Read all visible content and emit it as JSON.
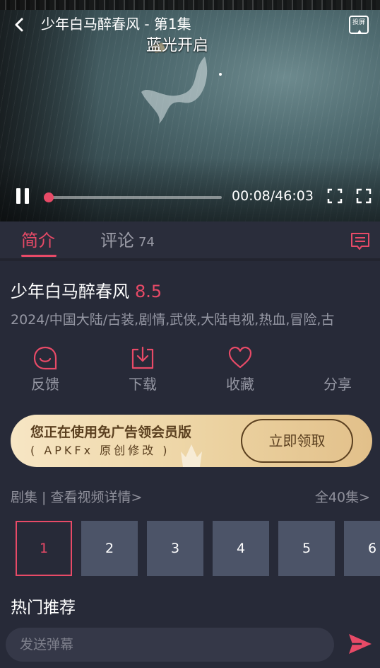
{
  "player": {
    "title": "少年白马醉春风 - 第1集",
    "overlay_text": "蓝光开启",
    "cast_label": "投屏",
    "time": "00:08/46:03",
    "progress": 0.003
  },
  "tabs": {
    "intro_label": "简介",
    "comments_label": "评论",
    "comments_count": "74"
  },
  "show": {
    "title": "少年白马醉春风",
    "rating": "8.5",
    "meta": "2024/中国大陆/古装,剧情,武侠,大陆电视,热血,冒险,古"
  },
  "actions": {
    "feedback": "反馈",
    "download": "下载",
    "favorite": "收藏",
    "share": "分享"
  },
  "banner": {
    "title": "您正在使用免广告领会员版",
    "subtitle": "( APKFx 原创修改 )",
    "button": "立即领取"
  },
  "episodes": {
    "header": "剧集 | 查看视频详情>",
    "all": "全40集>",
    "items": [
      "1",
      "2",
      "3",
      "4",
      "5",
      "6"
    ],
    "selected": "1"
  },
  "hot": {
    "title": "热门推荐"
  },
  "danmaku": {
    "placeholder": "发送弹幕"
  },
  "colors": {
    "accent": "#e84a67",
    "background": "#272a38",
    "episode_tile": "#4c5468",
    "banner_gold": "#ecd3a2",
    "banner_text": "#5a3f1f"
  },
  "icons": {
    "back": "chevron-left-icon",
    "cast": "cast-icon",
    "pause": "pause-icon",
    "pip": "picture-in-picture-icon",
    "fullscreen": "fullscreen-icon",
    "danmaku_list": "message-list-icon",
    "feedback": "smile-bubble-icon",
    "download": "download-icon",
    "favorite": "heart-icon",
    "share": "share-icon",
    "send": "send-icon"
  }
}
